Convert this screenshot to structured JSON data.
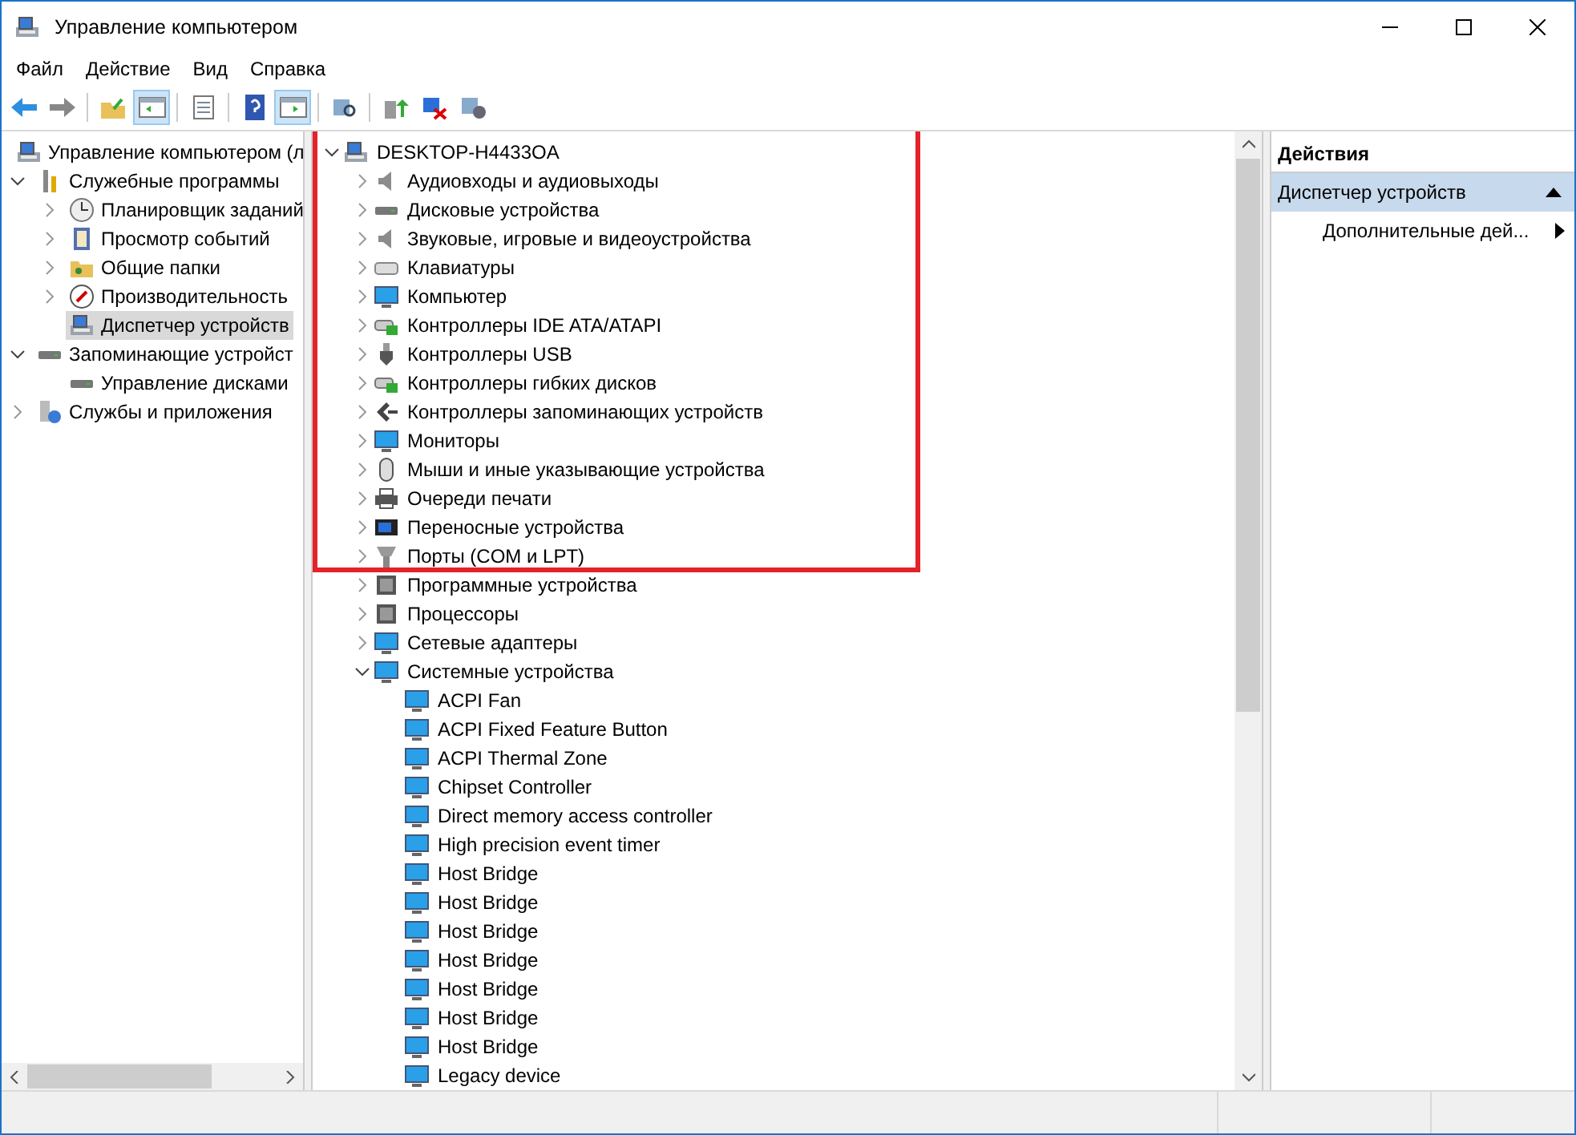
{
  "window": {
    "title": "Управление компьютером"
  },
  "menu": [
    "Файл",
    "Действие",
    "Вид",
    "Справка"
  ],
  "toolbar": [
    {
      "buttons": [
        {
          "selected": false
        },
        {
          "selected": false
        }
      ]
    },
    {
      "buttons": [
        {
          "selected": false
        },
        {
          "selected": true
        }
      ]
    },
    {
      "buttons": [
        {
          "selected": false
        }
      ]
    },
    {
      "buttons": [
        {
          "selected": false
        },
        {
          "selected": true
        }
      ]
    },
    {
      "buttons": [
        {
          "selected": false
        }
      ]
    },
    {
      "buttons": [
        {
          "selected": false
        },
        {
          "selected": false
        },
        {
          "selected": false
        }
      ]
    }
  ],
  "navigation_tree": [
    {
      "label": "Управление компьютером (л",
      "selected": false,
      "children": [
        {
          "label": "Служебные программы",
          "expanded": true,
          "selected": false,
          "children": [
            {
              "label": "Планировщик заданий",
              "expanded": false,
              "selected": false
            },
            {
              "label": "Просмотр событий",
              "expanded": false,
              "selected": false
            },
            {
              "label": "Общие папки",
              "expanded": false,
              "selected": false
            },
            {
              "label": "Производительность",
              "expanded": false,
              "selected": false
            },
            {
              "label": "Диспетчер устройств",
              "selected": true
            }
          ]
        },
        {
          "label": "Запоминающие устройст",
          "expanded": true,
          "selected": false,
          "children": [
            {
              "label": "Управление дисками",
              "selected": false
            }
          ]
        },
        {
          "label": "Службы и приложения",
          "expanded": false,
          "selected": false
        }
      ]
    }
  ],
  "device_tree": [
    {
      "label": "DESKTOP-H4433OA",
      "expanded": true,
      "children": [
        {
          "label": "Аудиовходы и аудиовыходы",
          "expanded": false
        },
        {
          "label": "Дисковые устройства",
          "expanded": false
        },
        {
          "label": "Звуковые, игровые и видеоустройства",
          "expanded": false
        },
        {
          "label": "Клавиатуры",
          "expanded": false
        },
        {
          "label": "Компьютер",
          "expanded": false
        },
        {
          "label": "Контроллеры IDE ATA/ATAPI",
          "expanded": false
        },
        {
          "label": "Контроллеры USB",
          "expanded": false
        },
        {
          "label": "Контроллеры гибких дисков",
          "expanded": false
        },
        {
          "label": "Контроллеры запоминающих устройств",
          "expanded": false
        },
        {
          "label": "Мониторы",
          "expanded": false
        },
        {
          "label": "Мыши и иные указывающие устройства",
          "expanded": false
        },
        {
          "label": "Очереди печати",
          "expanded": false
        },
        {
          "label": "Переносные устройства",
          "expanded": false
        },
        {
          "label": "Порты (COM и LPT)",
          "expanded": false
        },
        {
          "label": "Программные устройства",
          "expanded": false
        },
        {
          "label": "Процессоры",
          "expanded": false
        },
        {
          "label": "Сетевые адаптеры",
          "expanded": false
        },
        {
          "label": "Системные устройства",
          "expanded": true,
          "children": [
            {
              "label": "ACPI Fan"
            },
            {
              "label": "ACPI Fixed Feature Button"
            },
            {
              "label": "ACPI Thermal Zone"
            },
            {
              "label": "Chipset Controller"
            },
            {
              "label": "Direct memory access controller"
            },
            {
              "label": "High precision event timer"
            },
            {
              "label": "Host Bridge"
            },
            {
              "label": "Host Bridge"
            },
            {
              "label": "Host Bridge"
            },
            {
              "label": "Host Bridge"
            },
            {
              "label": "Host Bridge"
            },
            {
              "label": "Host Bridge"
            },
            {
              "label": "Host Bridge"
            },
            {
              "label": "Legacy device"
            }
          ]
        }
      ]
    }
  ],
  "annotation": {
    "kind": "frame",
    "color": "#e3222a"
  },
  "actions_pane": {
    "title": "Действия",
    "sections": [
      {
        "title": "Диспетчер устройств",
        "expanded": true,
        "items": [
          "Дополнительные дей..."
        ]
      }
    ]
  }
}
